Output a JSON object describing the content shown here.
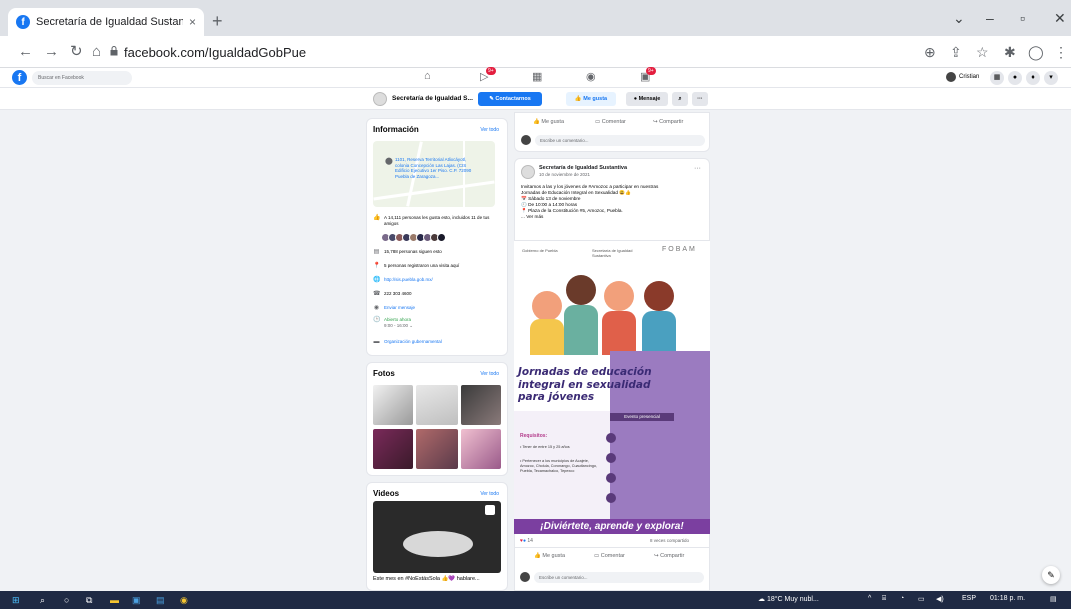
{
  "browser": {
    "tab_title": "Secretaría de Igualdad Sustantiv",
    "tab_close": "×",
    "new_tab": "+",
    "url": "facebook.com/IgualdadGobPue"
  },
  "fb": {
    "search_placeholder": "Buscar en Facebook",
    "badge1": "9+",
    "badge2": "9+",
    "user_name": "Cristian"
  },
  "page_header": {
    "name": "Secretaría de Igualdad S...",
    "btn_contact": "Contactarnos",
    "btn_like": "Me gusta",
    "btn_message": "Mensaje"
  },
  "info": {
    "title": "Información",
    "see_all": "Ver todo",
    "address": "1101, Reserva Territorial Atlixcáyotl, colonia Concepción Las Lajas. (CIS Edificio Ejecutivo 1er Piso. C.P. 72090 Puebla de Zaragoza...",
    "likes": "A 14,111 personas les gusta esto, incluidos 11 de tus amigos",
    "followers": "15,788 personas siguen esto",
    "checkins": "5 personas registraron una visita aquí",
    "website": "http://sis.puebla.gob.mx/",
    "phone": "222 303 4600",
    "send_message": "Enviar mensaje",
    "open_now": "Abierto ahora",
    "hours": "9:00 - 16:00",
    "category": "Organización gubernamental"
  },
  "photos": {
    "title": "Fotos",
    "see_all": "Ver todo"
  },
  "videos": {
    "title": "Videos",
    "see_all": "Ver todo",
    "caption": "Este mes en #NoEstásSola 👍💜 hablare..."
  },
  "post_actions": {
    "like": "Me gusta",
    "comment": "Comentar",
    "share": "Compartir",
    "write_comment": "Escribe un comentario..."
  },
  "post2": {
    "author": "Secretaría de Igualdad Sustantiva",
    "date": "10 de noviembre de 2021",
    "line1": "Invitamos a las y los jóvenes de #Amozoc a participar en nuestras",
    "line2": "Jornadas de Educación Integral en Sexualidad 😃👍",
    "line3": "📅 Sábado 13 de noviembre",
    "line4": "🕙 De 10:00 a 14:00 horas",
    "line5": "📍 Plaza de la Constitución #5, Amozoc, Puebla.",
    "see_more": "... Ver más"
  },
  "poster": {
    "logo_left": "Gobierno de Puebla",
    "logo_mid": "Secretaría de Igualdad Sustantiva",
    "logo_right": "FOBAM",
    "title_l1": "Jornadas de educación",
    "title_l2": "integral en sexualidad",
    "title_l3": "para jóvenes",
    "event_badge": "Evento presencial",
    "req_title": "Requisitos:",
    "req1": "• Tener de entre 15 y 25 años",
    "req2": "• Pertenecer a los municipios de Acajete, Amozoc, Cholula, Coronango, Cuautlancingo, Puebla, Tecamachalco, Tepexco",
    "bottom": "¡Diviértete, aprende y explora!"
  },
  "post_footer": {
    "reactions": "14",
    "shares": "8 veces compartido"
  },
  "taskbar": {
    "weather": "18°C Muy nubl...",
    "lang": "ESP",
    "time": "01:18 p. m."
  }
}
